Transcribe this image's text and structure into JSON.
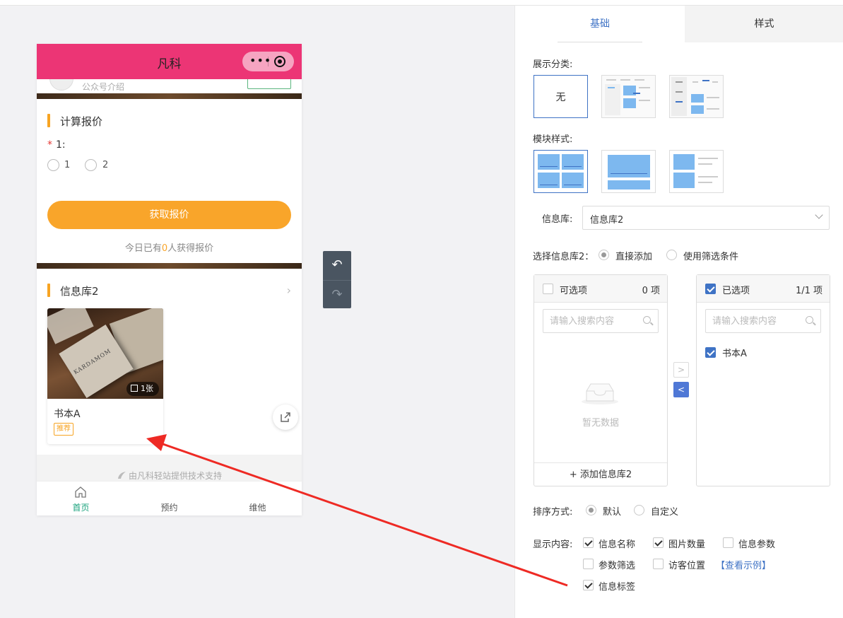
{
  "phone": {
    "title": "凡科",
    "profile_text": "公众号介绍",
    "quote_section": {
      "title": "计算报价",
      "required_mark": "*",
      "field_label": "1:",
      "options": [
        "1",
        "2"
      ],
      "button": "获取报价",
      "today_prefix": "今日已有",
      "today_count": "0",
      "today_suffix": "人获得报价"
    },
    "library_section": {
      "title": "信息库2",
      "chevron": "›",
      "card": {
        "name": "书本A",
        "image_count": "1张",
        "tag": "推荐",
        "image_box_text": "KARDAMOM"
      }
    },
    "footer_text": "由凡科轻站提供技术支持",
    "tabbar": [
      {
        "label": "首页",
        "icon": "home-icon",
        "active": true
      },
      {
        "label": "预约",
        "icon": "",
        "active": false
      },
      {
        "label": "维他",
        "icon": "",
        "active": false
      }
    ],
    "header_color": "#ec3575"
  },
  "undo": {
    "undo_icon": "↶",
    "redo_icon": "↷"
  },
  "panel": {
    "tabs": {
      "basic": "基础",
      "style": "样式"
    },
    "display_category_label": "展示分类:",
    "display_category_none": "无",
    "module_style_label": "模块样式:",
    "library_label": "信息库:",
    "library_value": "信息库2",
    "select_label": "选择信息库2：",
    "select_options": [
      "直接添加",
      "使用筛选条件"
    ],
    "available": {
      "title": "可选项",
      "count": "0 项",
      "search_placeholder": "请输入搜索内容",
      "empty": "暂无数据",
      "add": "+ 添加信息库2"
    },
    "selected": {
      "title": "已选项",
      "count": "1/1 项",
      "search_placeholder": "请输入搜索内容",
      "items": [
        "书本A"
      ]
    },
    "transfer_right": ">",
    "transfer_left": "<",
    "sort_label": "排序方式:",
    "sort_options": [
      "默认",
      "自定义"
    ],
    "content_label": "显示内容:",
    "content_options": [
      {
        "label": "信息名称",
        "checked": true
      },
      {
        "label": "图片数量",
        "checked": true
      },
      {
        "label": "信息参数",
        "checked": false
      },
      {
        "label": "参数筛选",
        "checked": false
      },
      {
        "label": "访客位置",
        "checked": false
      },
      {
        "label": "信息标签",
        "checked": true
      }
    ],
    "view_example": "【查看示例】",
    "accent_color": "#3f73c5"
  }
}
